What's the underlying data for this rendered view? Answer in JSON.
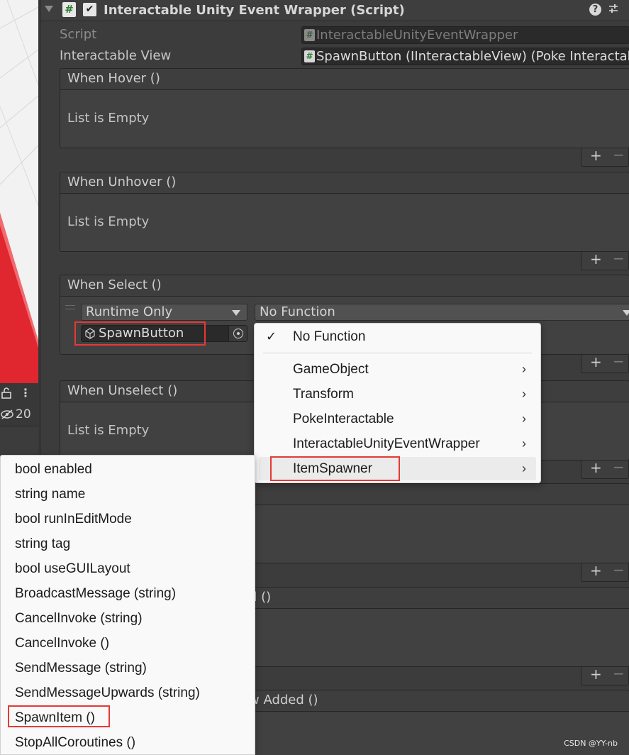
{
  "component": {
    "title": "Interactable Unity Event Wrapper (Script)",
    "script_icon": "#",
    "enabled_check": "✔",
    "help_icon": "?",
    "presets_icon": "⇌"
  },
  "properties": {
    "script_label": "Script",
    "script_value": "InteractableUnityEventWrapper",
    "view_label": "Interactable View",
    "view_value": "SpawnButton (IInteractableView) (Poke Interactab"
  },
  "events": {
    "when_hover": "When Hover ()",
    "when_unhover": "When Unhover ()",
    "when_select": "When Select ()",
    "when_unselect": "When Unselect ()",
    "partial_1": "d ()",
    "partial_2": "w Added ()",
    "list_empty": "List is Empty",
    "plus": "+",
    "minus": "−"
  },
  "select_entry": {
    "runtime": "Runtime Only",
    "function": "No Function",
    "target": "SpawnButton"
  },
  "scene_toolbar": {
    "lock_icon": "🔓",
    "menu_icon": "⋮",
    "hidden_count": "20"
  },
  "function_menu": {
    "check": "✓",
    "items": [
      {
        "label": "No Function",
        "checked": true
      },
      {
        "label": "GameObject",
        "submenu": true
      },
      {
        "label": "Transform",
        "submenu": true
      },
      {
        "label": "PokeInteractable",
        "submenu": true
      },
      {
        "label": "InteractableUnityEventWrapper",
        "submenu": true
      },
      {
        "label": "ItemSpawner",
        "submenu": true,
        "active": true
      }
    ],
    "chevron": "›"
  },
  "member_menu": {
    "items": [
      "bool enabled",
      "string name",
      "bool runInEditMode",
      "string tag",
      "bool useGUILayout",
      "BroadcastMessage (string)",
      "CancelInvoke (string)",
      "CancelInvoke ()",
      "SendMessage (string)",
      "SendMessageUpwards (string)",
      "SpawnItem ()",
      "StopAllCoroutines ()"
    ]
  },
  "watermark": "CSDN @YY-nb",
  "colors": {
    "highlight": "#e53935",
    "panel": "#3c3c3c",
    "menu": "#f9f9f9",
    "scene_red": "#e0262f"
  }
}
